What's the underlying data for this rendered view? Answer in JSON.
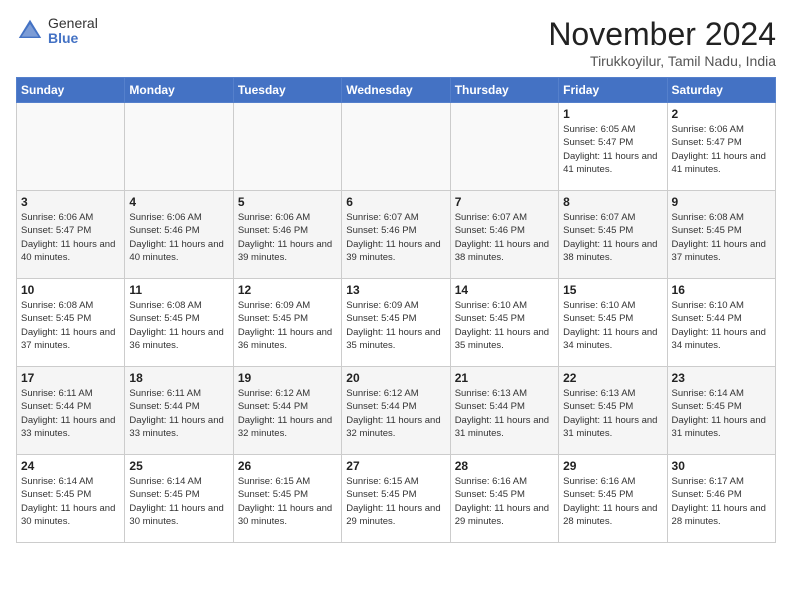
{
  "logo": {
    "general": "General",
    "blue": "Blue"
  },
  "title": "November 2024",
  "subtitle": "Tirukkoyilur, Tamil Nadu, India",
  "headers": [
    "Sunday",
    "Monday",
    "Tuesday",
    "Wednesday",
    "Thursday",
    "Friday",
    "Saturday"
  ],
  "weeks": [
    [
      {
        "day": "",
        "info": ""
      },
      {
        "day": "",
        "info": ""
      },
      {
        "day": "",
        "info": ""
      },
      {
        "day": "",
        "info": ""
      },
      {
        "day": "",
        "info": ""
      },
      {
        "day": "1",
        "info": "Sunrise: 6:05 AM\nSunset: 5:47 PM\nDaylight: 11 hours and 41 minutes."
      },
      {
        "day": "2",
        "info": "Sunrise: 6:06 AM\nSunset: 5:47 PM\nDaylight: 11 hours and 41 minutes."
      }
    ],
    [
      {
        "day": "3",
        "info": "Sunrise: 6:06 AM\nSunset: 5:47 PM\nDaylight: 11 hours and 40 minutes."
      },
      {
        "day": "4",
        "info": "Sunrise: 6:06 AM\nSunset: 5:46 PM\nDaylight: 11 hours and 40 minutes."
      },
      {
        "day": "5",
        "info": "Sunrise: 6:06 AM\nSunset: 5:46 PM\nDaylight: 11 hours and 39 minutes."
      },
      {
        "day": "6",
        "info": "Sunrise: 6:07 AM\nSunset: 5:46 PM\nDaylight: 11 hours and 39 minutes."
      },
      {
        "day": "7",
        "info": "Sunrise: 6:07 AM\nSunset: 5:46 PM\nDaylight: 11 hours and 38 minutes."
      },
      {
        "day": "8",
        "info": "Sunrise: 6:07 AM\nSunset: 5:45 PM\nDaylight: 11 hours and 38 minutes."
      },
      {
        "day": "9",
        "info": "Sunrise: 6:08 AM\nSunset: 5:45 PM\nDaylight: 11 hours and 37 minutes."
      }
    ],
    [
      {
        "day": "10",
        "info": "Sunrise: 6:08 AM\nSunset: 5:45 PM\nDaylight: 11 hours and 37 minutes."
      },
      {
        "day": "11",
        "info": "Sunrise: 6:08 AM\nSunset: 5:45 PM\nDaylight: 11 hours and 36 minutes."
      },
      {
        "day": "12",
        "info": "Sunrise: 6:09 AM\nSunset: 5:45 PM\nDaylight: 11 hours and 36 minutes."
      },
      {
        "day": "13",
        "info": "Sunrise: 6:09 AM\nSunset: 5:45 PM\nDaylight: 11 hours and 35 minutes."
      },
      {
        "day": "14",
        "info": "Sunrise: 6:10 AM\nSunset: 5:45 PM\nDaylight: 11 hours and 35 minutes."
      },
      {
        "day": "15",
        "info": "Sunrise: 6:10 AM\nSunset: 5:45 PM\nDaylight: 11 hours and 34 minutes."
      },
      {
        "day": "16",
        "info": "Sunrise: 6:10 AM\nSunset: 5:44 PM\nDaylight: 11 hours and 34 minutes."
      }
    ],
    [
      {
        "day": "17",
        "info": "Sunrise: 6:11 AM\nSunset: 5:44 PM\nDaylight: 11 hours and 33 minutes."
      },
      {
        "day": "18",
        "info": "Sunrise: 6:11 AM\nSunset: 5:44 PM\nDaylight: 11 hours and 33 minutes."
      },
      {
        "day": "19",
        "info": "Sunrise: 6:12 AM\nSunset: 5:44 PM\nDaylight: 11 hours and 32 minutes."
      },
      {
        "day": "20",
        "info": "Sunrise: 6:12 AM\nSunset: 5:44 PM\nDaylight: 11 hours and 32 minutes."
      },
      {
        "day": "21",
        "info": "Sunrise: 6:13 AM\nSunset: 5:44 PM\nDaylight: 11 hours and 31 minutes."
      },
      {
        "day": "22",
        "info": "Sunrise: 6:13 AM\nSunset: 5:45 PM\nDaylight: 11 hours and 31 minutes."
      },
      {
        "day": "23",
        "info": "Sunrise: 6:14 AM\nSunset: 5:45 PM\nDaylight: 11 hours and 31 minutes."
      }
    ],
    [
      {
        "day": "24",
        "info": "Sunrise: 6:14 AM\nSunset: 5:45 PM\nDaylight: 11 hours and 30 minutes."
      },
      {
        "day": "25",
        "info": "Sunrise: 6:14 AM\nSunset: 5:45 PM\nDaylight: 11 hours and 30 minutes."
      },
      {
        "day": "26",
        "info": "Sunrise: 6:15 AM\nSunset: 5:45 PM\nDaylight: 11 hours and 30 minutes."
      },
      {
        "day": "27",
        "info": "Sunrise: 6:15 AM\nSunset: 5:45 PM\nDaylight: 11 hours and 29 minutes."
      },
      {
        "day": "28",
        "info": "Sunrise: 6:16 AM\nSunset: 5:45 PM\nDaylight: 11 hours and 29 minutes."
      },
      {
        "day": "29",
        "info": "Sunrise: 6:16 AM\nSunset: 5:45 PM\nDaylight: 11 hours and 28 minutes."
      },
      {
        "day": "30",
        "info": "Sunrise: 6:17 AM\nSunset: 5:46 PM\nDaylight: 11 hours and 28 minutes."
      }
    ]
  ]
}
